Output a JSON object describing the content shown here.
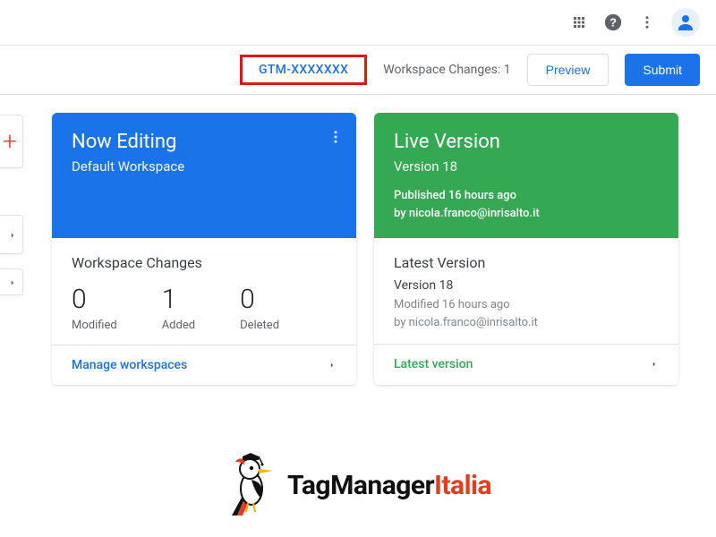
{
  "header": {
    "container_id": "GTM-XXXXXXX",
    "workspace_changes_label": "Workspace Changes: 1",
    "preview_label": "Preview",
    "submit_label": "Submit"
  },
  "now_editing": {
    "title": "Now Editing",
    "subtitle": "Default Workspace",
    "changes_title": "Workspace Changes",
    "stats": {
      "modified": {
        "value": "0",
        "label": "Modified"
      },
      "added": {
        "value": "1",
        "label": "Added"
      },
      "deleted": {
        "value": "0",
        "label": "Deleted"
      }
    },
    "footer_link": "Manage workspaces"
  },
  "live_version": {
    "title": "Live Version",
    "subtitle": "Version 18",
    "published_line": "Published 16 hours ago",
    "by_line": "by nicola.franco@inrisalto.it",
    "latest_title": "Latest Version",
    "latest_sub": "Version 18",
    "latest_meta1": "Modified 16 hours ago",
    "latest_meta2": "by nicola.franco@inrisalto.it",
    "footer_link": "Latest version"
  },
  "branding": {
    "part1": "TagManager",
    "part2": "Italia"
  }
}
